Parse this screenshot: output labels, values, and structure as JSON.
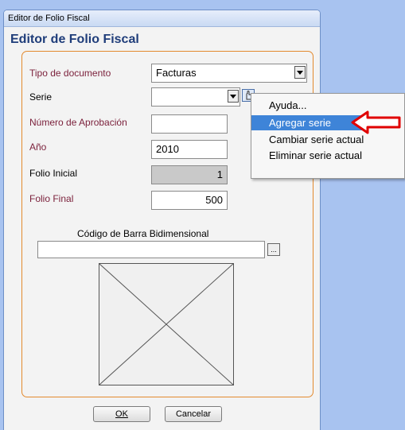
{
  "window": {
    "title": "Editor de Folio Fiscal",
    "heading": "Editor de Folio Fiscal"
  },
  "form": {
    "tipo_label": "Tipo de documento",
    "tipo_value": "Facturas",
    "serie_label": "Serie",
    "serie_value": "",
    "aprobacion_label": "Número de Aprobación",
    "aprobacion_value": "",
    "anio_label": "Año",
    "anio_value": "2010",
    "folio_inicial_label": "Folio Inicial",
    "folio_inicial_value": "1",
    "folio_final_label": "Folio Final",
    "folio_final_value": "500",
    "codigo_label": "Código de Barra Bidimensional",
    "codigo_value": "",
    "browse_label": "..."
  },
  "buttons": {
    "ok": "OK",
    "cancel": "Cancelar"
  },
  "context_menu": {
    "items": [
      "Ayuda...",
      "Agregar serie",
      "Cambiar serie actual",
      "Eliminar serie actual"
    ],
    "highlighted": "Agregar serie"
  },
  "colors": {
    "accent_label": "#7a1f3a",
    "heading": "#1f3d7a",
    "group_border": "#e38a2e",
    "highlight": "#3e84d8",
    "arrow": "#e00000"
  }
}
